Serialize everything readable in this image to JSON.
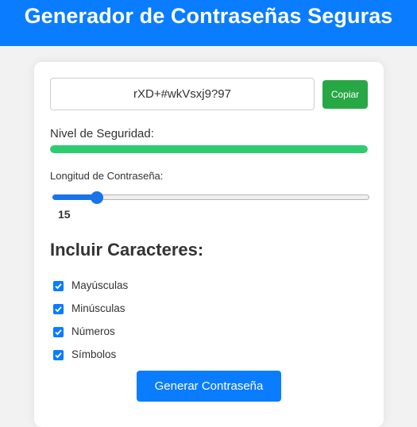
{
  "header": {
    "title": "Generador de Contraseñas Seguras"
  },
  "password": {
    "value": "rXD+#wkVsxj9?97",
    "copy_label": "Copiar"
  },
  "security": {
    "label": "Nivel de Seguridad:",
    "level": 1.0,
    "color": "#2ecc71"
  },
  "length": {
    "label": "Longitud de Contraseña:",
    "value": "15",
    "min": 8,
    "max": 64
  },
  "include": {
    "title": "Incluir Caracteres:",
    "options": [
      {
        "label": "Mayúsculas",
        "checked": true
      },
      {
        "label": "Minúsculas",
        "checked": true
      },
      {
        "label": "Números",
        "checked": true
      },
      {
        "label": "Símbolos",
        "checked": true
      }
    ]
  },
  "generate": {
    "label": "Generar Contraseña"
  },
  "colors": {
    "header": "#0a7cff",
    "copy": "#28a745",
    "primary": "#0a7cff"
  }
}
